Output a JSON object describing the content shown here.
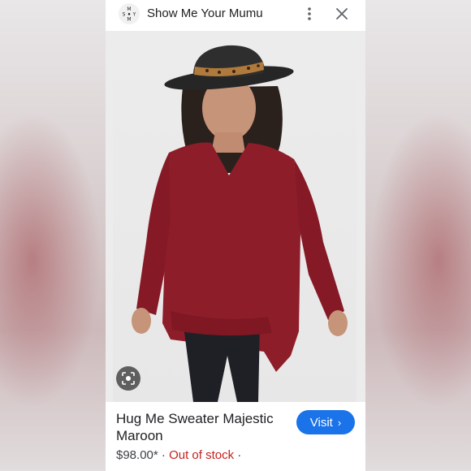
{
  "header": {
    "site_name": "Show Me Your Mumu",
    "logo_text": "SMYM",
    "more_icon": "more-vert-icon",
    "close_icon": "close-icon"
  },
  "product": {
    "title": "Hug Me Sweater Majestic Maroon",
    "price": "$98.00*",
    "separator": "·",
    "stock_status": "Out of stock",
    "trailing_separator": "·"
  },
  "actions": {
    "visit_label": "Visit",
    "visit_chevron": "›",
    "lens_icon": "image-search-icon"
  },
  "colors": {
    "accent": "#1a73e8",
    "out_of_stock": "#c5221f",
    "sweater": "#8e1d2a"
  }
}
